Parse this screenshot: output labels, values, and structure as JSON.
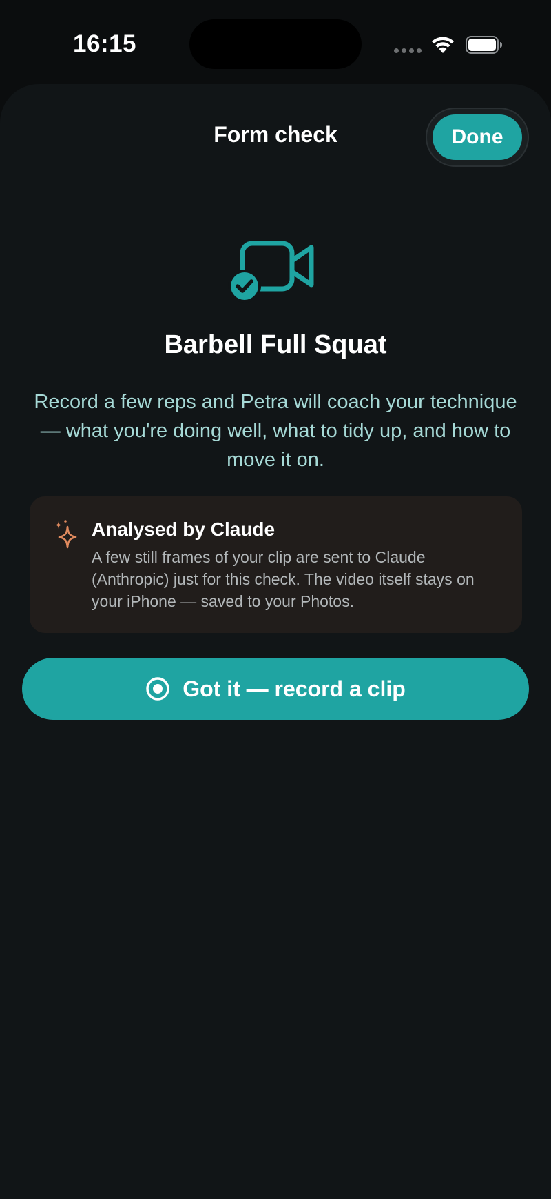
{
  "status_bar": {
    "time": "16:15"
  },
  "sheet": {
    "title": "Form check",
    "done_label": "Done"
  },
  "hero": {
    "icon": "video-camera-check-icon",
    "exercise_title": "Barbell Full Squat",
    "description": "Record a few reps and Petra will coach your technique — what you're doing well, what to tidy up, and how to move it on."
  },
  "info_card": {
    "icon": "sparkle-icon",
    "title": "Analysed by Claude",
    "body": "A few still frames of your clip are sent to Claude (Anthropic) just for this check. The video itself stays on your iPhone — saved to your Photos."
  },
  "record_button": {
    "icon": "record-icon",
    "label": "Got it — record a clip"
  },
  "colors": {
    "accent": "#1fa4a2",
    "background": "#111517",
    "sparkle": "#e08a5e",
    "description_text": "#a6d9d6"
  }
}
